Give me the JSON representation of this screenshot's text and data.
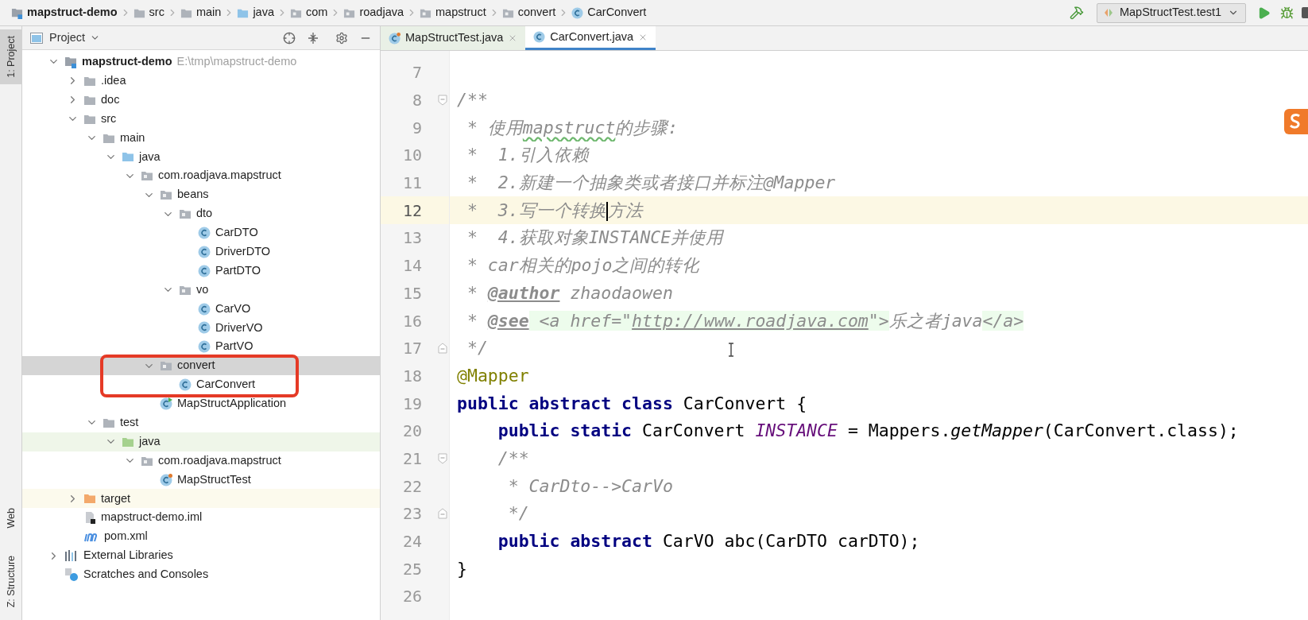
{
  "breadcrumbs": [
    {
      "label": "mapstruct-demo",
      "kind": "module"
    },
    {
      "label": "src",
      "kind": "folder"
    },
    {
      "label": "main",
      "kind": "folder"
    },
    {
      "label": "java",
      "kind": "source"
    },
    {
      "label": "com",
      "kind": "package"
    },
    {
      "label": "roadjava",
      "kind": "package"
    },
    {
      "label": "mapstruct",
      "kind": "package"
    },
    {
      "label": "convert",
      "kind": "package"
    },
    {
      "label": "CarConvert",
      "kind": "class"
    }
  ],
  "run_config": {
    "label": "MapStructTest.test1"
  },
  "left_stripe": {
    "top": [
      {
        "label": "1: Project",
        "selected": true
      }
    ],
    "bottom": [
      {
        "label": "Web",
        "selected": false
      },
      {
        "label": "Z: Structure",
        "selected": false
      }
    ]
  },
  "project_panel": {
    "title": "Project",
    "tree": [
      {
        "label": "mapstruct-demo",
        "hint": "E:\\tmp\\mapstruct-demo",
        "kind": "module",
        "expanded": true,
        "selected": false,
        "children": [
          {
            "label": ".idea",
            "kind": "folder",
            "expanded": false,
            "selected": false
          },
          {
            "label": "doc",
            "kind": "folder",
            "expanded": false,
            "selected": false
          },
          {
            "label": "src",
            "kind": "folder",
            "expanded": true,
            "selected": false,
            "children": [
              {
                "label": "main",
                "kind": "folder",
                "expanded": true,
                "selected": false,
                "children": [
                  {
                    "label": "java",
                    "kind": "source",
                    "expanded": true,
                    "selected": false,
                    "children": [
                      {
                        "label": "com.roadjava.mapstruct",
                        "kind": "package",
                        "expanded": true,
                        "selected": false,
                        "children": [
                          {
                            "label": "beans",
                            "kind": "package",
                            "expanded": true,
                            "selected": false,
                            "children": [
                              {
                                "label": "dto",
                                "kind": "package",
                                "expanded": true,
                                "selected": false,
                                "children": [
                                  {
                                    "label": "CarDTO",
                                    "kind": "class",
                                    "selected": false
                                  },
                                  {
                                    "label": "DriverDTO",
                                    "kind": "class",
                                    "selected": false
                                  },
                                  {
                                    "label": "PartDTO",
                                    "kind": "class",
                                    "selected": false
                                  }
                                ]
                              },
                              {
                                "label": "vo",
                                "kind": "package",
                                "expanded": true,
                                "selected": false,
                                "children": [
                                  {
                                    "label": "CarVO",
                                    "kind": "class",
                                    "selected": false
                                  },
                                  {
                                    "label": "DriverVO",
                                    "kind": "class",
                                    "selected": false
                                  },
                                  {
                                    "label": "PartVO",
                                    "kind": "class",
                                    "selected": false
                                  }
                                ]
                              }
                            ]
                          },
                          {
                            "label": "convert",
                            "kind": "package",
                            "expanded": true,
                            "selected": true,
                            "children": [
                              {
                                "label": "CarConvert",
                                "kind": "class",
                                "selected": false
                              }
                            ]
                          },
                          {
                            "label": "MapStructApplication",
                            "kind": "app-class",
                            "selected": false
                          }
                        ]
                      }
                    ]
                  }
                ]
              },
              {
                "label": "test",
                "kind": "folder",
                "expanded": true,
                "selected": false,
                "children": [
                  {
                    "label": "java",
                    "kind": "test-source",
                    "expanded": true,
                    "selected": false,
                    "children": [
                      {
                        "label": "com.roadjava.mapstruct",
                        "kind": "package",
                        "expanded": true,
                        "selected": false,
                        "children": [
                          {
                            "label": "MapStructTest",
                            "kind": "test-class",
                            "selected": false
                          }
                        ]
                      }
                    ]
                  }
                ]
              }
            ]
          },
          {
            "label": "target",
            "kind": "excluded",
            "expanded": false,
            "selected": false
          },
          {
            "label": "mapstruct-demo.iml",
            "kind": "iml",
            "selected": false
          },
          {
            "label": "pom.xml",
            "kind": "maven",
            "selected": false
          }
        ]
      },
      {
        "label": "External Libraries",
        "kind": "libraries",
        "expanded": false,
        "selected": false
      },
      {
        "label": "Scratches and Consoles",
        "kind": "scratches",
        "selected": false
      }
    ]
  },
  "tabs": [
    {
      "label": "MapStructTest.java",
      "kind": "test-class",
      "selected": false
    },
    {
      "label": "CarConvert.java",
      "kind": "class",
      "selected": true
    }
  ],
  "code_lines": [
    {
      "number": "7",
      "current": false
    },
    {
      "number": "8",
      "current": false,
      "kind": "fold-start",
      "tokens": [
        {
          "kind": "comment",
          "text": "/**"
        }
      ]
    },
    {
      "number": "9",
      "current": false,
      "tokens": [
        {
          "kind": "comment",
          "text": " * 使用"
        },
        {
          "kind": "typo",
          "text": "mapstruct"
        },
        {
          "kind": "comment",
          "text": "的步骤:"
        }
      ]
    },
    {
      "number": "10",
      "current": false,
      "tokens": [
        {
          "kind": "comment",
          "text": " *  1.引入依赖"
        }
      ]
    },
    {
      "number": "11",
      "current": false,
      "tokens": [
        {
          "kind": "comment",
          "text": " *  2.新建一个抽象类或者接口并标注@Mapper"
        }
      ]
    },
    {
      "number": "12",
      "current": true,
      "tokens": [
        {
          "kind": "comment",
          "text": " *  3.写一个转换"
        },
        {
          "kind": "caret"
        },
        {
          "kind": "comment",
          "text": "方法"
        }
      ]
    },
    {
      "number": "13",
      "current": false,
      "tokens": [
        {
          "kind": "comment",
          "text": " *  4.获取对象INSTANCE并使用"
        }
      ]
    },
    {
      "number": "14",
      "current": false,
      "tokens": [
        {
          "kind": "comment",
          "text": " * car相关的pojo之间的转化"
        }
      ]
    },
    {
      "number": "15",
      "current": false,
      "tokens": [
        {
          "kind": "comment",
          "text": " * "
        },
        {
          "kind": "doctag",
          "text": "@author"
        },
        {
          "kind": "comment",
          "text": " zhaodaowen"
        }
      ]
    },
    {
      "number": "16",
      "current": false,
      "tokens": [
        {
          "kind": "comment",
          "text": " * "
        },
        {
          "kind": "doctag",
          "text": "@see"
        },
        {
          "kind": "html",
          "text": " <a href=\""
        },
        {
          "kind": "url",
          "text": "http://www.roadjava.com"
        },
        {
          "kind": "html",
          "text": "\">"
        },
        {
          "kind": "comment",
          "text": "乐之者java"
        },
        {
          "kind": "html",
          "text": "</a>"
        }
      ]
    },
    {
      "number": "17",
      "current": false,
      "kind": "fold-end",
      "tokens": [
        {
          "kind": "comment",
          "text": " */"
        }
      ]
    },
    {
      "number": "18",
      "current": false,
      "tokens": [
        {
          "kind": "annotation",
          "text": "@Mapper"
        }
      ]
    },
    {
      "number": "19",
      "current": false,
      "tokens": [
        {
          "kind": "keyword",
          "text": "public abstract class "
        },
        {
          "kind": "plain",
          "text": "CarConvert {"
        }
      ]
    },
    {
      "number": "20",
      "current": false,
      "tokens": [
        {
          "kind": "keyword",
          "text": "    public static "
        },
        {
          "kind": "plain",
          "text": "CarConvert "
        },
        {
          "kind": "static",
          "text": "INSTANCE"
        },
        {
          "kind": "plain",
          "text": " = Mappers."
        },
        {
          "kind": "method",
          "text": "getMapper"
        },
        {
          "kind": "plain",
          "text": "(CarConvert.class);"
        }
      ]
    },
    {
      "number": "21",
      "current": false,
      "kind": "fold-start",
      "tokens": [
        {
          "kind": "comment",
          "text": "    /**"
        }
      ]
    },
    {
      "number": "22",
      "current": false,
      "tokens": [
        {
          "kind": "comment",
          "text": "     * CarDto-->CarVo"
        }
      ]
    },
    {
      "number": "23",
      "current": false,
      "kind": "fold-end",
      "tokens": [
        {
          "kind": "comment",
          "text": "     */"
        }
      ]
    },
    {
      "number": "24",
      "current": false,
      "tokens": [
        {
          "kind": "keyword",
          "text": "    public abstract "
        },
        {
          "kind": "plain",
          "text": "CarVO abc(CarDTO carDTO);"
        }
      ]
    },
    {
      "number": "25",
      "current": false,
      "tokens": [
        {
          "kind": "plain",
          "text": "}"
        }
      ]
    },
    {
      "number": "26",
      "current": false
    }
  ]
}
